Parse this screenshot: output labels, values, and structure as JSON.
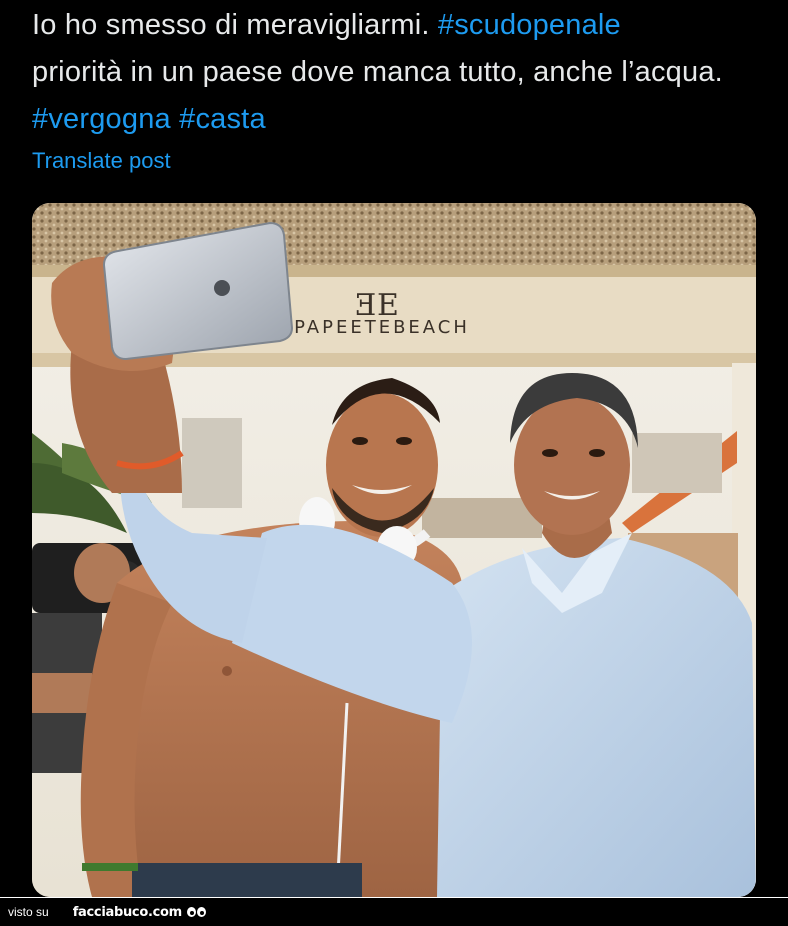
{
  "post": {
    "text_part1": "Io ho smesso di meravigliarmi. ",
    "hashtag1": "#scudopenale",
    "text_part2": "priorità in un paese dove manca tutto, anche l’acqua. ",
    "hashtag2": "#vergogna",
    "hashtag3": "#casta",
    "translate_label": "Translate post"
  },
  "photo": {
    "sign_text": "PAPEETEBEACH"
  },
  "footer": {
    "prefix": "visto su",
    "brand": "facciabuco.com"
  },
  "colors": {
    "background": "#000000",
    "text": "#e7e9ea",
    "link": "#1d9bf0"
  }
}
